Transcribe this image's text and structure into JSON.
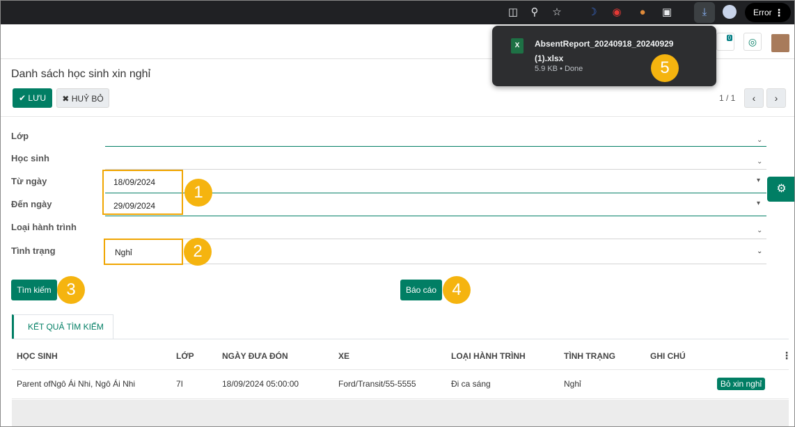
{
  "browser": {
    "error_label": "Error"
  },
  "topbar": {
    "notification_count": "0"
  },
  "page": {
    "title": "Danh sách học sinh xin nghỉ",
    "save_label": "LƯU",
    "cancel_label": "HUỶ BỎ",
    "pager": "1 / 1"
  },
  "form": {
    "class_label": "Lớp",
    "student_label": "Học sinh",
    "from_date_label": "Từ ngày",
    "from_date_value": "18/09/2024",
    "to_date_label": "Đến ngày",
    "to_date_value": "29/09/2024",
    "trip_type_label": "Loại hành trình",
    "status_label": "Tình trạng",
    "status_value": "Nghỉ"
  },
  "actions": {
    "search_label": "Tìm kiếm",
    "report_label": "Báo cáo"
  },
  "markers": [
    "1",
    "2",
    "3",
    "4",
    "5"
  ],
  "results": {
    "tab_label": "KẾT QUẢ TÌM KIẾM",
    "columns": [
      "HỌC SINH",
      "LỚP",
      "NGÀY ĐƯA ĐÓN",
      "XE",
      "LOẠI HÀNH TRÌNH",
      "TÌNH TRẠNG",
      "GHI CHÚ"
    ],
    "rows": [
      {
        "student": "Parent ofNgô Ái Nhi, Ngô Ái Nhi",
        "class": "7I",
        "date": "18/09/2024 05:00:00",
        "vehicle": "Ford/Transit/55-5555",
        "trip_type": "Đi ca sáng",
        "status": "Nghỉ",
        "action_label": "Bỏ xin nghỉ"
      }
    ]
  },
  "download": {
    "file_name": "AbsentReport_20240918_20240929 (1).xlsx",
    "status": "5.9 KB • Done"
  },
  "colors": {
    "primary": "#017e64",
    "marker": "#f5b40f",
    "highlight": "#f0a500",
    "chrome_dark": "#202124"
  }
}
